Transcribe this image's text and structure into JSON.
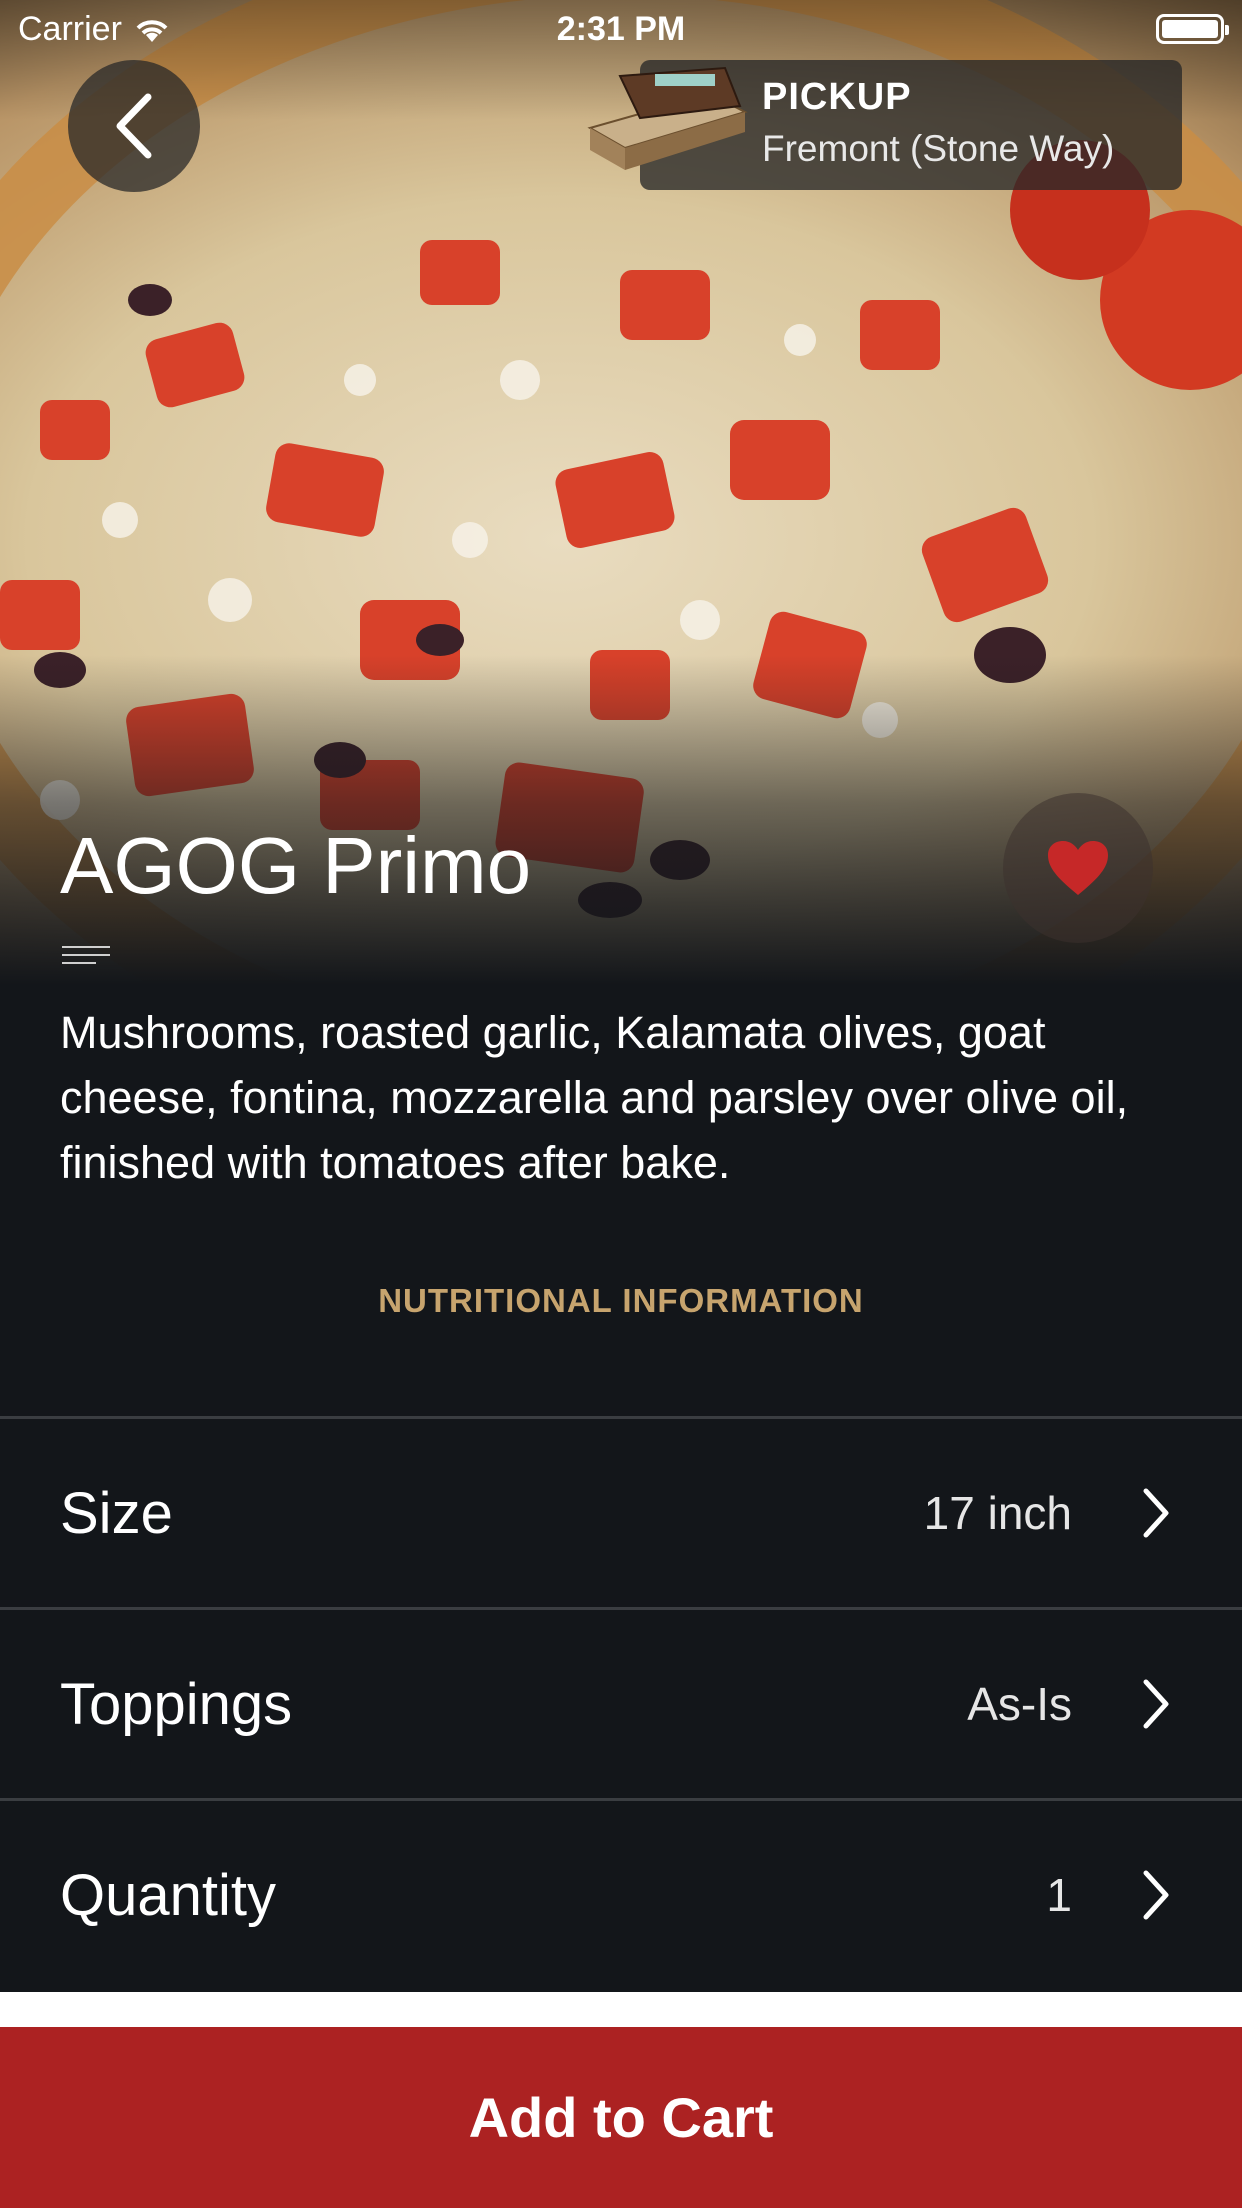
{
  "status_bar": {
    "carrier": "Carrier",
    "time": "2:31 PM",
    "battery_level": 1.0
  },
  "header": {
    "back_icon": "chevron-left-icon",
    "pickup": {
      "mode": "PICKUP",
      "location": "Fremont (Stone Way)"
    }
  },
  "item": {
    "title": "AGOG Primo",
    "favorite": true,
    "description": "Mushrooms, roasted garlic, Kalamata olives, goat cheese, fontina, mozzarella and parsley over olive oil, finished with tomatoes after bake."
  },
  "nutritional_link": "NUTRITIONAL INFORMATION",
  "options": [
    {
      "label": "Size",
      "value": "17 inch"
    },
    {
      "label": "Toppings",
      "value": "As-Is"
    },
    {
      "label": "Quantity",
      "value": "1"
    }
  ],
  "cart_button": "Add to Cart",
  "colors": {
    "accent": "#ac2222",
    "link": "#c7a46e",
    "background": "#13161a",
    "heart": "#c62828"
  }
}
